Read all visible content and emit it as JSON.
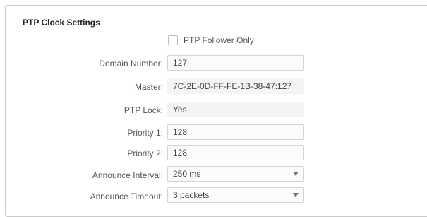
{
  "section": {
    "title": "PTP Clock Settings"
  },
  "follower_only": {
    "label": "PTP Follower Only",
    "checked": false
  },
  "domain_number": {
    "label": "Domain Number:",
    "value": "127"
  },
  "master": {
    "label": "Master:",
    "value": "7C-2E-0D-FF-FE-1B-38-47:127"
  },
  "ptp_lock": {
    "label": "PTP Lock:",
    "value": "Yes"
  },
  "priority1": {
    "label": "Priority 1:",
    "value": "128"
  },
  "priority2": {
    "label": "Priority 2:",
    "value": "128"
  },
  "announce_interval": {
    "label": "Announce Interval:",
    "value": "250 ms"
  },
  "announce_timeout": {
    "label": "Announce Timeout:",
    "value": "3 packets"
  },
  "icons": {
    "dropdown": "chevron-down-icon",
    "checkbox": "checkbox-icon"
  }
}
